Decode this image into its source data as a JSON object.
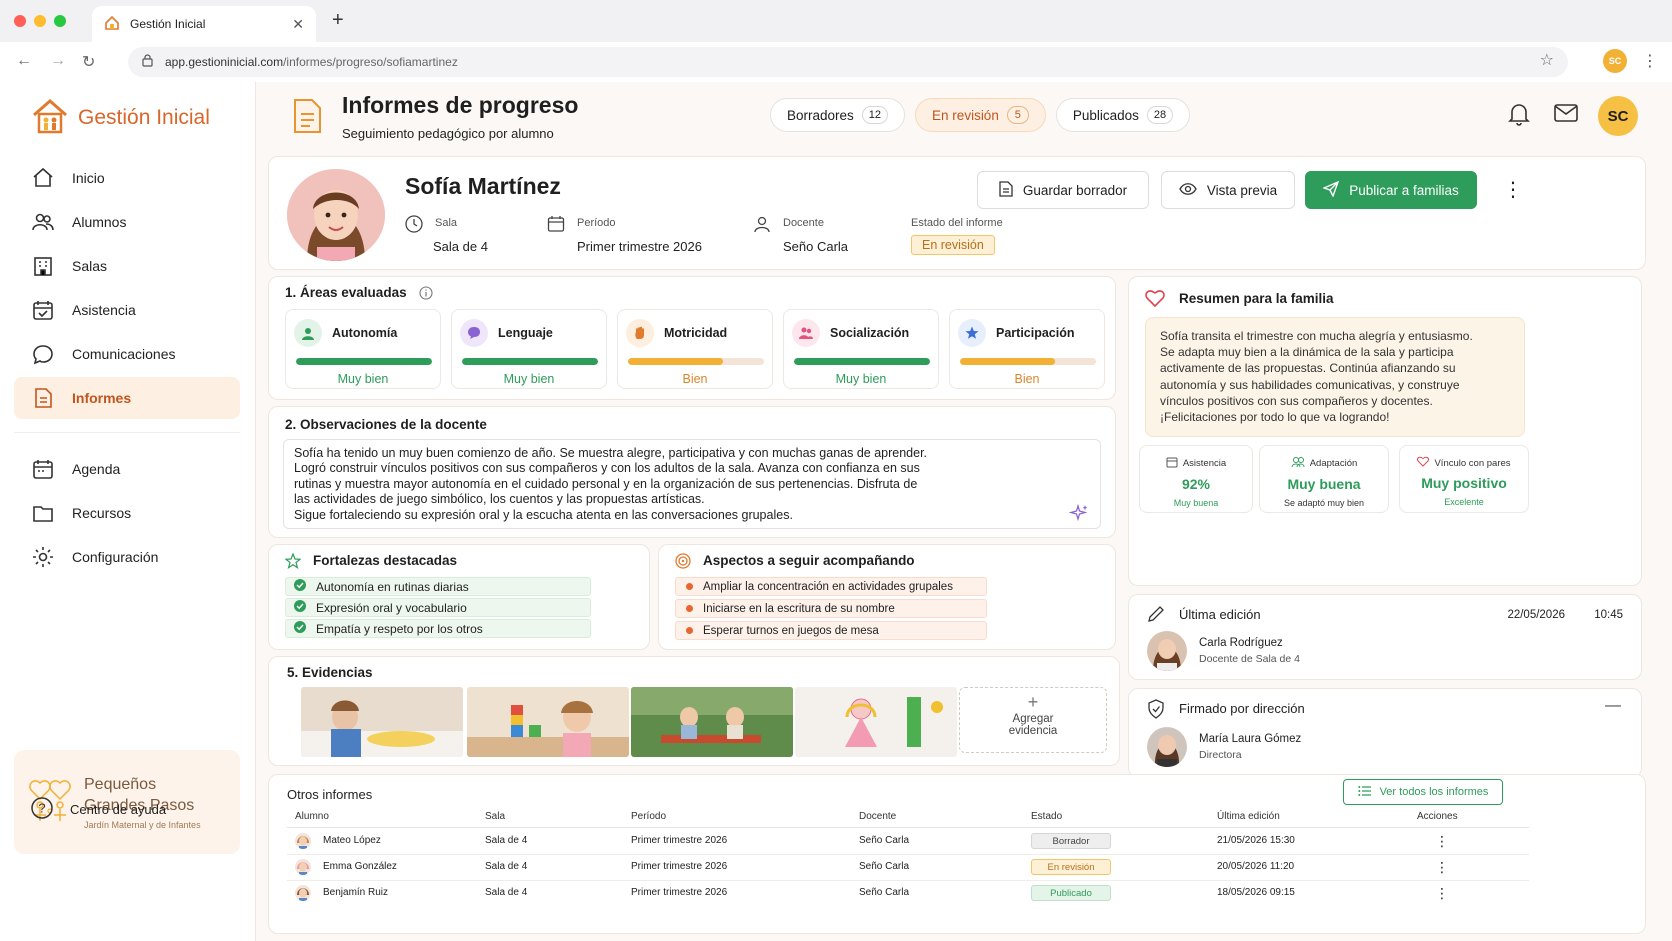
{
  "browser": {
    "tab_title": "Gestión Inicial",
    "url_host": "app.gestioninicial.com",
    "url_path": "/informes/progreso/sofiamartinez",
    "profile": "SC"
  },
  "sidebar": {
    "brand": "Gestión Inicial",
    "items": [
      {
        "label": "Inicio",
        "icon": "home-icon"
      },
      {
        "label": "Alumnos",
        "icon": "users-icon"
      },
      {
        "label": "Salas",
        "icon": "building-icon"
      },
      {
        "label": "Asistencia",
        "icon": "calendar-check-icon"
      },
      {
        "label": "Comunicaciones",
        "icon": "chat-icon"
      },
      {
        "label": "Informes",
        "icon": "document-icon"
      }
    ],
    "items2": [
      {
        "label": "Agenda",
        "icon": "calendar-icon"
      },
      {
        "label": "Recursos",
        "icon": "folder-icon"
      },
      {
        "label": "Configuración",
        "icon": "gear-icon"
      }
    ],
    "promo": {
      "line1": "Pequeños",
      "line2": "Grandes Pasos",
      "sub": "Jardín Maternal y de Infantes"
    },
    "help": "Centro de ayuda"
  },
  "header": {
    "title": "Informes de progreso",
    "subtitle": "Seguimiento pedagógico por alumno",
    "tabs": [
      {
        "label": "Borradores",
        "count": "12"
      },
      {
        "label": "En revisión",
        "count": "5"
      },
      {
        "label": "Publicados",
        "count": "28"
      }
    ],
    "avatar": "SC"
  },
  "student": {
    "name": "Sofía Martínez",
    "sala_label": "Sala",
    "sala": "Sala de 4",
    "periodo_label": "Período",
    "periodo": "Primer trimestre 2026",
    "docente_label": "Docente",
    "docente": "Seño Carla",
    "estado_label": "Estado del informe",
    "estado": "En revisión"
  },
  "actions": {
    "save": "Guardar borrador",
    "preview": "Vista previa",
    "publish": "Publicar a familias"
  },
  "areas": {
    "title": "1. Áreas evaluadas",
    "items": [
      {
        "name": "Autonomía",
        "level": "Muy bien",
        "progress": 1.0,
        "color": "#2e9c5b",
        "bg": "#e3f3e8",
        "icon": "person-icon"
      },
      {
        "name": "Lenguaje",
        "level": "Muy bien",
        "progress": 1.0,
        "color": "#2e9c5b",
        "bg": "#efe6fb",
        "icon": "speech-icon"
      },
      {
        "name": "Motricidad",
        "level": "Bien",
        "progress": 0.7,
        "color": "#f2b035",
        "bg": "#fdeedd",
        "icon": "hand-icon"
      },
      {
        "name": "Socialización",
        "level": "Muy bien",
        "progress": 1.0,
        "color": "#2e9c5b",
        "bg": "#fde6ee",
        "icon": "group-icon"
      },
      {
        "name": "Participación",
        "level": "Bien",
        "progress": 0.7,
        "color": "#f2b035",
        "bg": "#e7eefc",
        "icon": "star-icon"
      }
    ]
  },
  "observations": {
    "title": "2. Observaciones de la docente",
    "lines": [
      "Sofía ha tenido un muy buen comienzo de año. Se muestra alegre, participativa y con muchas ganas de aprender.",
      "Logró construir vínculos positivos con sus compañeros y con los adultos de la sala. Avanza con confianza en sus",
      "rutinas y muestra mayor autonomía en el cuidado personal y en la organización de sus pertenencias. Disfruta de",
      "las actividades de juego simbólico, los cuentos y las propuestas artísticas.",
      "Sigue fortaleciendo su expresión oral y la escucha atenta en las conversaciones grupales."
    ]
  },
  "strengths": {
    "title": "Fortalezas destacadas",
    "items": [
      "Autonomía en rutinas diarias",
      "Expresión oral y vocabulario",
      "Empatía y respeto por los otros"
    ]
  },
  "follow": {
    "title": "Aspectos a seguir acompañando",
    "items": [
      "Ampliar la concentración en actividades grupales",
      "Iniciarse en la escritura de su nombre",
      "Esperar turnos en juegos de mesa"
    ]
  },
  "evidence": {
    "title": "5. Evidencias",
    "add_line1": "Agregar",
    "add_line2": "evidencia"
  },
  "summary": {
    "title": "Resumen para la familia",
    "lines": [
      "Sofía transita el trimestre con mucha alegría y entusiasmo.",
      "Se adapta muy bien a la dinámica de la sala y participa",
      "activamente de las propuestas. Continúa afianzando su",
      "autonomía y sus habilidades comunicativas, y construye",
      "vínculos positivos con sus compañeros y docentes.",
      "¡Felicitaciones por todo lo que va logrando!"
    ],
    "stats": [
      {
        "label": "Asistencia",
        "value": "92%",
        "sub": "Muy buena"
      },
      {
        "label": "Adaptación",
        "value": "Muy buena",
        "sub": "Se adaptó muy bien"
      },
      {
        "label": "Vínculo con pares",
        "value": "Muy positivo",
        "sub": "Excelente"
      }
    ]
  },
  "last_edit": {
    "title": "Última edición",
    "date": "22/05/2026",
    "time": "10:45",
    "name": "Carla Rodríguez",
    "role": "Docente de Sala de 4"
  },
  "signed": {
    "title": "Firmado por dirección",
    "name": "María Laura Gómez",
    "role": "Directora"
  },
  "others": {
    "title": "Otros informes",
    "view_all": "Ver todos los informes",
    "headers": [
      "Alumno",
      "Sala",
      "Período",
      "Docente",
      "Estado",
      "Última edición",
      "Acciones"
    ],
    "rows": [
      {
        "alumno": "Mateo López",
        "sala": "Sala de 4",
        "periodo": "Primer trimestre 2026",
        "docente": "Seño Carla",
        "estado": "Borrador",
        "edicion": "21/05/2026 15:30"
      },
      {
        "alumno": "Emma González",
        "sala": "Sala de 4",
        "periodo": "Primer trimestre 2026",
        "docente": "Seño Carla",
        "estado": "En revisión",
        "edicion": "20/05/2026 11:20"
      },
      {
        "alumno": "Benjamín Ruiz",
        "sala": "Sala de 4",
        "periodo": "Primer trimestre 2026",
        "docente": "Seño Carla",
        "estado": "Publicado",
        "edicion": "18/05/2026 09:15"
      }
    ]
  }
}
